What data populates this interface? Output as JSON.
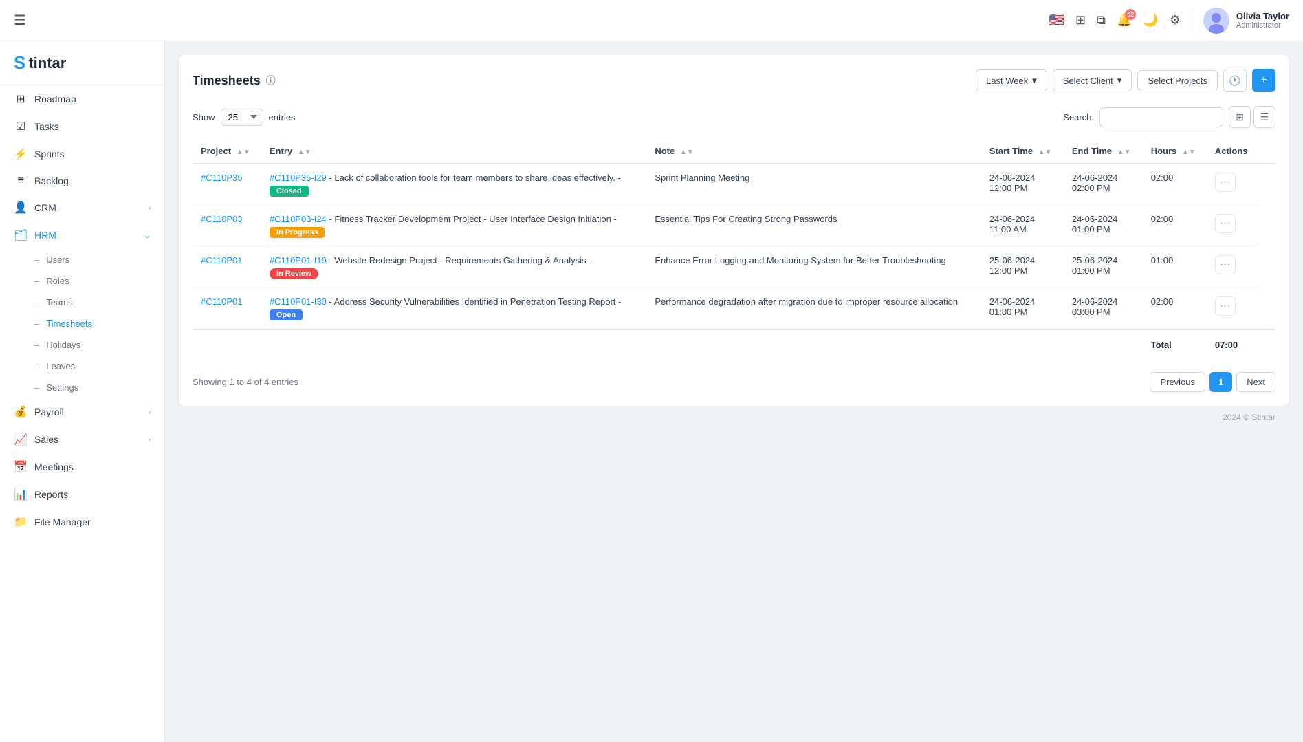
{
  "header": {
    "menu_icon": "☰",
    "notification_count": "52",
    "user": {
      "name": "Olivia Taylor",
      "role": "Administrator"
    }
  },
  "sidebar": {
    "logo": "Stintar",
    "nav_items": [
      {
        "id": "roadmap",
        "label": "Roadmap",
        "icon": "⊞",
        "has_arrow": false
      },
      {
        "id": "tasks",
        "label": "Tasks",
        "icon": "☑",
        "has_arrow": false
      },
      {
        "id": "sprints",
        "label": "Sprints",
        "icon": "⚡",
        "has_arrow": false
      },
      {
        "id": "backlog",
        "label": "Backlog",
        "icon": "≡",
        "has_arrow": false
      },
      {
        "id": "crm",
        "label": "CRM",
        "icon": "👤",
        "has_arrow": true
      },
      {
        "id": "hrm",
        "label": "HRM",
        "icon": "🗂",
        "has_arrow": true,
        "active": true
      }
    ],
    "hrm_sub_items": [
      {
        "id": "users",
        "label": "Users"
      },
      {
        "id": "roles",
        "label": "Roles"
      },
      {
        "id": "teams",
        "label": "Teams"
      },
      {
        "id": "timesheets",
        "label": "Timesheets",
        "active": true
      },
      {
        "id": "holidays",
        "label": "Holidays"
      },
      {
        "id": "leaves",
        "label": "Leaves"
      },
      {
        "id": "settings",
        "label": "Settings"
      }
    ],
    "bottom_items": [
      {
        "id": "payroll",
        "label": "Payroll",
        "icon": "💰",
        "has_arrow": true
      },
      {
        "id": "sales",
        "label": "Sales",
        "icon": "📈",
        "has_arrow": true
      },
      {
        "id": "meetings",
        "label": "Meetings",
        "icon": "📅",
        "has_arrow": false
      },
      {
        "id": "reports",
        "label": "Reports",
        "icon": "📊",
        "has_arrow": false
      },
      {
        "id": "file_manager",
        "label": "File Manager",
        "icon": "📁",
        "has_arrow": false
      }
    ]
  },
  "timesheets": {
    "title": "Timesheets",
    "filter_last_week": "Last Week",
    "filter_client": "Select Client",
    "filter_projects": "Select Projects",
    "show_label": "Show",
    "show_value": "25",
    "entries_label": "entries",
    "search_label": "Search:",
    "search_placeholder": "",
    "columns": [
      {
        "id": "project",
        "label": "Project"
      },
      {
        "id": "entry",
        "label": "Entry"
      },
      {
        "id": "note",
        "label": "Note"
      },
      {
        "id": "start_time",
        "label": "Start Time"
      },
      {
        "id": "end_time",
        "label": "End Time"
      },
      {
        "id": "hours",
        "label": "Hours"
      },
      {
        "id": "actions",
        "label": "Actions"
      }
    ],
    "rows": [
      {
        "project": "#C110P35",
        "entry_id": "#C110P35-I29",
        "entry_text": "Lack of collaboration tools for team members to share ideas effectively.",
        "badge": "Closed",
        "badge_class": "badge-closed",
        "note": "Sprint Planning Meeting",
        "start_date": "24-06-2024",
        "start_time": "12:00 PM",
        "end_date": "24-06-2024",
        "end_time": "02:00 PM",
        "hours": "02:00"
      },
      {
        "project": "#C110P03",
        "entry_id": "#C110P03-I24",
        "entry_text": "Fitness Tracker Development Project - User Interface Design Initiation",
        "badge": "In Progress",
        "badge_class": "badge-in-progress",
        "note": "Essential Tips For Creating Strong Passwords",
        "start_date": "24-06-2024",
        "start_time": "11:00 AM",
        "end_date": "24-06-2024",
        "end_time": "01:00 PM",
        "hours": "02:00"
      },
      {
        "project": "#C110P01",
        "entry_id": "#C110P01-I19",
        "entry_text": "Website Redesign Project - Requirements Gathering & Analysis",
        "badge": "In Review",
        "badge_class": "badge-in-review",
        "note": "Enhance Error Logging and Monitoring System for Better Troubleshooting",
        "start_date": "25-06-2024",
        "start_time": "12:00 PM",
        "end_date": "25-06-2024",
        "end_time": "01:00 PM",
        "hours": "01:00"
      },
      {
        "project": "#C110P01",
        "entry_id": "#C110P01-I30",
        "entry_text": "Address Security Vulnerabilities Identified in Penetration Testing Report",
        "badge": "Open",
        "badge_class": "badge-open",
        "note": "Performance degradation after migration due to improper resource allocation",
        "start_date": "24-06-2024",
        "start_time": "01:00 PM",
        "end_date": "24-06-2024",
        "end_time": "03:00 PM",
        "hours": "02:00"
      }
    ],
    "total_label": "Total",
    "total_hours": "07:00",
    "showing_text": "Showing 1 to 4 of 4 entries",
    "prev_label": "Previous",
    "page_num": "1",
    "next_label": "Next"
  },
  "copyright": "2024 © Stintar"
}
